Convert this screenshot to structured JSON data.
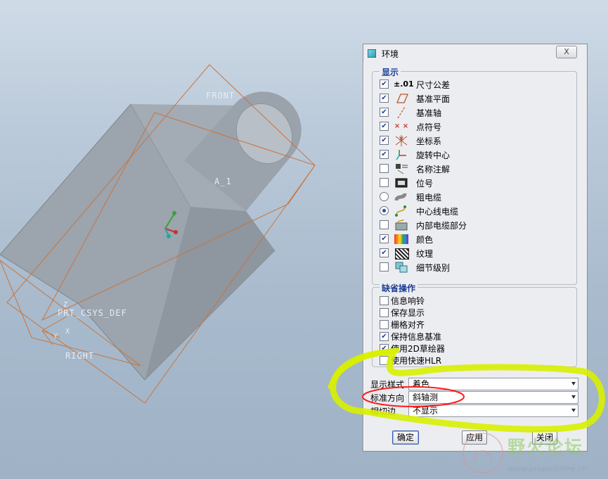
{
  "viewport": {
    "labels": {
      "front": "FRONT",
      "axis": "A_1",
      "csys": "PRT_CSYS_DEF",
      "right": "RIGHT",
      "x": "X",
      "y": "Y",
      "z": "Z"
    }
  },
  "dialog": {
    "title": "环境",
    "close_label": "X",
    "display_group": {
      "title": "显示",
      "items": [
        {
          "label": "尺寸公差",
          "icon": "dimension-tolerance-icon",
          "icon_text": "±.01",
          "control": "checkbox",
          "checked": true
        },
        {
          "label": "基准平面",
          "icon": "datum-plane-icon",
          "control": "checkbox",
          "checked": true
        },
        {
          "label": "基准轴",
          "icon": "datum-axis-icon",
          "control": "checkbox",
          "checked": true
        },
        {
          "label": "点符号",
          "icon": "point-symbol-icon",
          "control": "checkbox",
          "checked": true
        },
        {
          "label": "坐标系",
          "icon": "coordinate-system-icon",
          "control": "checkbox",
          "checked": true
        },
        {
          "label": "旋转中心",
          "icon": "spin-center-icon",
          "control": "checkbox",
          "checked": true
        },
        {
          "label": "名称注解",
          "icon": "name-note-icon",
          "control": "checkbox",
          "checked": false
        },
        {
          "label": "位号",
          "icon": "ref-designator-icon",
          "control": "checkbox",
          "checked": false
        },
        {
          "label": "粗电缆",
          "icon": "thick-cable-icon",
          "control": "radio",
          "checked": false
        },
        {
          "label": "中心线电缆",
          "icon": "centerline-cable-icon",
          "control": "radio",
          "checked": true
        },
        {
          "label": "内部电缆部分",
          "icon": "internal-cable-icon",
          "control": "checkbox",
          "checked": false
        },
        {
          "label": "颜色",
          "icon": "color-icon",
          "control": "checkbox",
          "checked": true
        },
        {
          "label": "纹理",
          "icon": "texture-icon",
          "control": "checkbox",
          "checked": true
        },
        {
          "label": "细节级别",
          "icon": "level-of-detail-icon",
          "control": "checkbox",
          "checked": false
        }
      ]
    },
    "default_actions_group": {
      "title": "缺省操作",
      "items": [
        {
          "label": "信息响铃",
          "checked": false
        },
        {
          "label": "保存显示",
          "checked": false
        },
        {
          "label": "栅格对齐",
          "checked": false
        },
        {
          "label": "保持信息基准",
          "checked": true
        },
        {
          "label": "使用2D草绘器",
          "checked": true
        },
        {
          "label": "使用快速HLR",
          "checked": false
        }
      ]
    },
    "selects": {
      "display_style": {
        "label": "显示样式",
        "value": "着色"
      },
      "standard_orientation": {
        "label": "标准方向",
        "value": "斜轴测"
      },
      "tangent_edges": {
        "label": "相切边",
        "value": "不显示"
      }
    },
    "buttons": {
      "ok": "确定",
      "apply": "应用",
      "close": "关闭"
    }
  },
  "watermark": {
    "text": "野火论坛",
    "url": "www.proewildfire.cn"
  },
  "colors": {
    "group_title": "#1c3f95",
    "highlight_yellow": "#d8f000",
    "highlight_red": "#ff1a1a",
    "datum_orange": "#c8753e"
  }
}
